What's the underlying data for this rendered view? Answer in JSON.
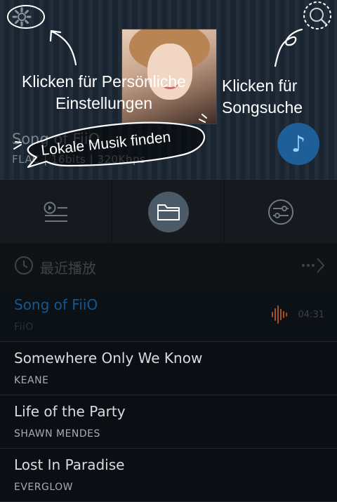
{
  "now_playing": {
    "title": "Song of FiiO",
    "meta": "FLAC | 16bits | 320Kbps"
  },
  "tutorial": {
    "settings_tip": "Klicken für Persönliche Einstellungen",
    "search_tip": "Klicken für Songsuche",
    "local_music_tip": "Lokale Musik finden"
  },
  "tabs": [
    {
      "icon": "playlist-icon"
    },
    {
      "icon": "folder-icon",
      "active": true
    },
    {
      "icon": "equalizer-icon"
    }
  ],
  "recent": {
    "title": "最近播放"
  },
  "songs": [
    {
      "title": "Song of FiiO",
      "artist": "FiiO",
      "duration": "04:31",
      "playing": true
    },
    {
      "title": "Somewhere Only We Know",
      "artist": "KEANE"
    },
    {
      "title": "Life of the Party",
      "artist": "SHAWN MENDES"
    },
    {
      "title": "Lost In Paradise",
      "artist": "EVERGLOW"
    }
  ],
  "colors": {
    "accent": "#1e5f9a",
    "playing_title": "#17578d",
    "playing_wave": "#a4521e"
  }
}
